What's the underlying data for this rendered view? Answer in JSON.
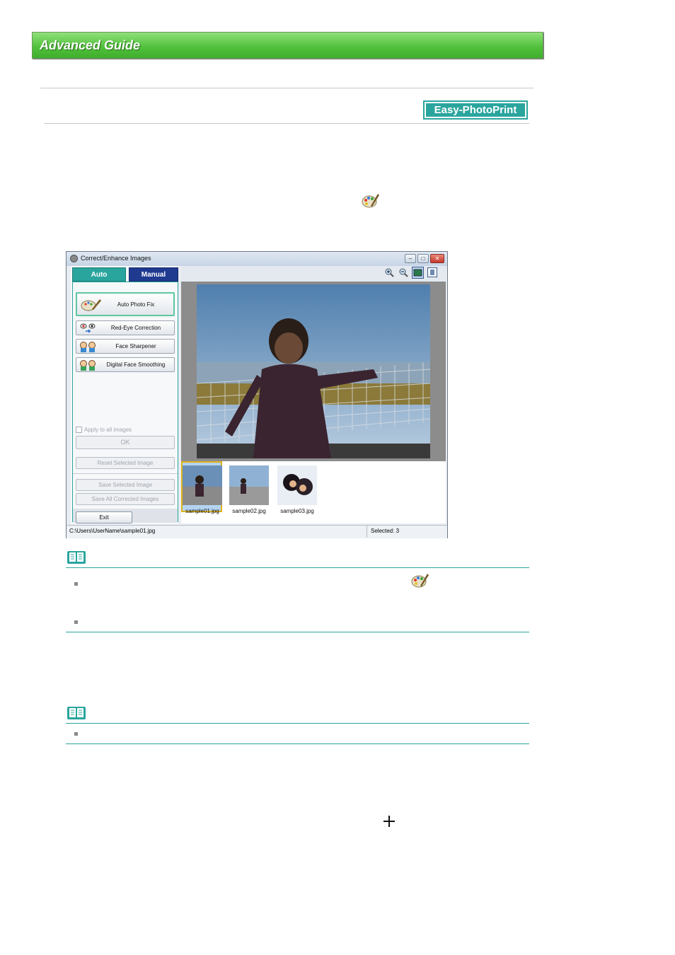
{
  "header": {
    "title": "Advanced Guide"
  },
  "product_badge": "Easy-PhotoPrint EX",
  "window": {
    "title": "Correct/Enhance Images",
    "controls": {
      "minimize": "–",
      "maximize": "□",
      "close": "✕"
    },
    "tabs": [
      {
        "label": "Auto"
      },
      {
        "label": "Manual"
      }
    ],
    "function_buttons": [
      {
        "label": "Auto Photo Fix"
      },
      {
        "label": "Red-Eye Correction"
      },
      {
        "label": "Face Sharpener"
      },
      {
        "label": "Digital Face Smoothing"
      }
    ],
    "apply_all_label": "Apply to all images",
    "ok_label": "OK",
    "reset_label": "Reset Selected Image",
    "save_selected_label": "Save Selected Image",
    "save_all_label": "Save All Corrected Images",
    "exit_label": "Exit",
    "thumbnails": [
      {
        "name": "sample01.jpg"
      },
      {
        "name": "sample02.jpg"
      },
      {
        "name": "sample03.jpg"
      }
    ],
    "status_path": "C:\\Users\\UserName\\sample01.jpg",
    "status_selected": "Selected: 3"
  },
  "colors": {
    "accent": "#2aa59e",
    "banner_green": "#4fbf3a",
    "manual_tab": "#1f3a8f"
  },
  "icons": [
    "palette-icon",
    "note-book-icon",
    "zoom-in-icon",
    "zoom-out-icon",
    "whole-image-view-icon",
    "list-view-icon",
    "plus-icon"
  ]
}
